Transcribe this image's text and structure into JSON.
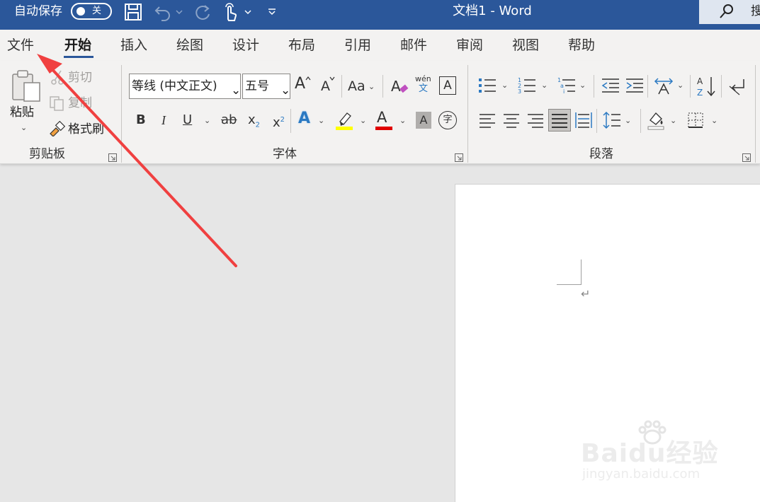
{
  "titlebar": {
    "autosave_label": "自动保存",
    "autosave_state": "关",
    "window_title": "文档1  -  Word",
    "search_label": "搜"
  },
  "tabs": [
    {
      "label": "文件"
    },
    {
      "label": "开始"
    },
    {
      "label": "插入"
    },
    {
      "label": "绘图"
    },
    {
      "label": "设计"
    },
    {
      "label": "布局"
    },
    {
      "label": "引用"
    },
    {
      "label": "邮件"
    },
    {
      "label": "审阅"
    },
    {
      "label": "视图"
    },
    {
      "label": "帮助"
    }
  ],
  "clipboard": {
    "paste_label": "粘贴",
    "cut_label": "剪切",
    "copy_label": "复制",
    "format_painter_label": "格式刷",
    "group_label": "剪贴板"
  },
  "font": {
    "font_name": "等线 (中文正文)",
    "font_size": "五号",
    "grow_label": "A",
    "shrink_label": "A",
    "case_label": "Aa",
    "phonetic_top": "wén",
    "phonetic_bottom": "文",
    "border_label": "A",
    "bold": "B",
    "italic": "I",
    "underline": "U",
    "strike": "ab",
    "subscript": "x",
    "superscript": "x",
    "sub_suffix": "2",
    "sup_suffix": "2",
    "effects_label": "A",
    "font_color_label": "A",
    "shading_label": "A",
    "enclose_label": "字",
    "group_label": "字体"
  },
  "paragraph": {
    "group_label": "段落"
  },
  "colors": {
    "titlebar": "#2b579a",
    "highlight": "#ffff00",
    "font_color": "#e00000",
    "arrow": "#f04040"
  },
  "watermark": {
    "main": "Baidu经验",
    "sub": "jingyan.baidu.com"
  }
}
